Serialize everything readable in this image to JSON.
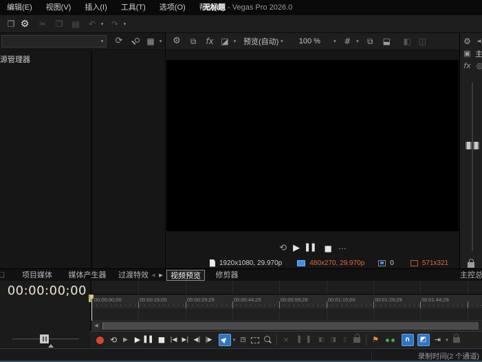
{
  "menu": {
    "items": [
      "编辑(E)",
      "视图(V)",
      "插入(I)",
      "工具(T)",
      "选项(O)",
      "帮助(H)"
    ]
  },
  "window": {
    "title_name": "无标题",
    "title_app": " - Vegas Pro 2026.0"
  },
  "icons": {
    "external": "❐",
    "gear": "⚙",
    "cut": "✂",
    "copy": "❐",
    "paste": "▤",
    "undo": "↶",
    "redo": "↷",
    "dropdown": "▾",
    "refresh": "⟳",
    "grid_view": "▦",
    "fx": "fx",
    "split_screen": "◪",
    "hash": "#",
    "snapshot_copy": "⧉",
    "save_snapshot": "⬓",
    "overlay_a": "◧",
    "overlay_b": "◫",
    "loop": "⟲",
    "play": "▶",
    "pause": "▌▌",
    "stop": "■",
    "more": "⋯",
    "goto_start": "|◀",
    "goto_end": "▶|",
    "prev_frame": "◀|",
    "next_frame": "|▶",
    "tool_arrow": "▶",
    "tool_group": "◳",
    "close_x": "×",
    "trim1": "▐",
    "trim2": "▌",
    "trim3": "◧",
    "trim4": "◨",
    "trim5": "▯",
    "flag": "⚑",
    "magnet": "∩",
    "tool_envelope": "◩",
    "ripple": "⇥",
    "scroll_left": "◀",
    "scroll_right": "▶",
    "master_square": "▣",
    "plugin": "◎",
    "speaker": "◄)",
    "dock": "❏"
  },
  "explorer": {
    "tree_item": "资源管理器",
    "address_value": ""
  },
  "preview": {
    "mode_label": "预览(自动)",
    "zoom_level": "100 %",
    "status": {
      "project_format": "1920x1080, 29.970p",
      "preview_format": "480x270, 29.970p",
      "frames_dropped": "0",
      "display_size": "571x321"
    }
  },
  "mixer": {
    "bus_name": "主控总线"
  },
  "dock_tabs": {
    "items": [
      "项目媒体",
      "媒体产生器",
      "过渡特效",
      "视频预览",
      "修剪器"
    ],
    "active": "视频预览",
    "master_tab": "主控总线"
  },
  "timeline": {
    "timecode": "00:00:00;00",
    "ruler": [
      "00:00:00;00",
      "00:00:15;00",
      "00:00:29;29",
      "00:00:44;29",
      "00:00:59;28",
      "00:01:15;00",
      "00:01:29;29",
      "00:01:44;29"
    ]
  },
  "statusbar": {
    "record_info": "录制时间(2 个通道)"
  },
  "colors": {
    "accent_blue": "#2f74c0",
    "orange_text": "#dd6a3f",
    "record_red": "#d9442e",
    "marker_orange": "#e8923e",
    "marker_green": "#3fae49",
    "cursor_yellow": "#cdbd6b",
    "video_black": "#000000"
  }
}
